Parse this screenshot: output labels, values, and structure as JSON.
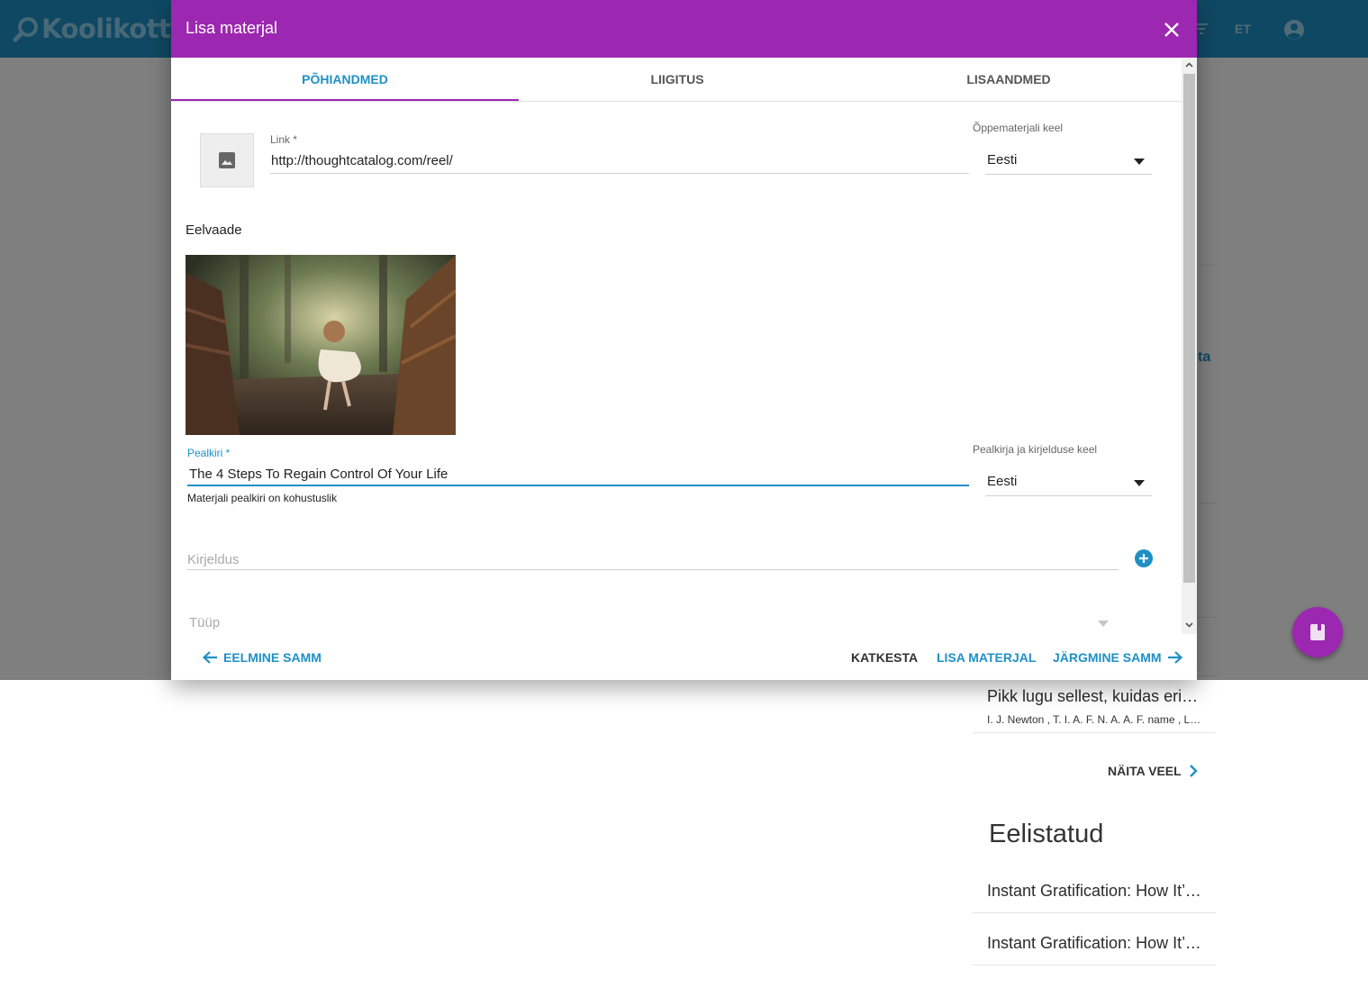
{
  "app": {
    "logo_text": "Koolikott",
    "language": "ET"
  },
  "sidebar": {
    "items": [
      {
        "title": "Pikk lugu sellest, kuidas erinevad ...",
        "authors": "I. J. Newton , T. I. A. F. N. A. A. F. name , L. ..."
      }
    ],
    "show_more_label": "NÄITA VEEL",
    "recommended_heading": "Eelistatud",
    "recommended_items": [
      {
        "title": "Instant Gratification: How It’s Hurting ..."
      },
      {
        "title": "Instant Gratification: How It’s Hurting ..."
      }
    ]
  },
  "dialog": {
    "title": "Lisa materjal",
    "tabs": [
      {
        "label": "PÕHIANDMED",
        "active": true
      },
      {
        "label": "LIIGITUS",
        "active": false
      },
      {
        "label": "LISAANDMED",
        "active": false
      }
    ],
    "link": {
      "label": "Link *",
      "value": "http://thoughtcatalog.com/reel/"
    },
    "material_language": {
      "label": "Õppematerjali keel",
      "value": "Eesti"
    },
    "preview_label": "Eelvaade",
    "title_field": {
      "label": "Pealkiri *",
      "value": "The 4 Steps To Regain Control Of Your Life",
      "hint": "Materjali pealkiri on kohustuslik"
    },
    "title_language": {
      "label": "Pealkirja ja kirjelduse keel",
      "value": "Eesti"
    },
    "description": {
      "placeholder": "Kirjeldus"
    },
    "type": {
      "placeholder": "Tüüp"
    },
    "buttons": {
      "previous": "EELMINE SAMM",
      "cancel": "KATKESTA",
      "add": "LISA MATERJAL",
      "next": "JÄRGMINE SAMM"
    }
  },
  "colors": {
    "primary_purple": "#9c27b0",
    "accent_blue": "#1e90c6",
    "app_bar_blue": "#1e90c6"
  },
  "icons": [
    "search-icon",
    "account-circle-icon",
    "filter-icon",
    "close-icon",
    "image-icon",
    "add-circle-icon",
    "arrow-back-icon",
    "arrow-forward-icon",
    "chevron-right-icon",
    "book-icon"
  ]
}
